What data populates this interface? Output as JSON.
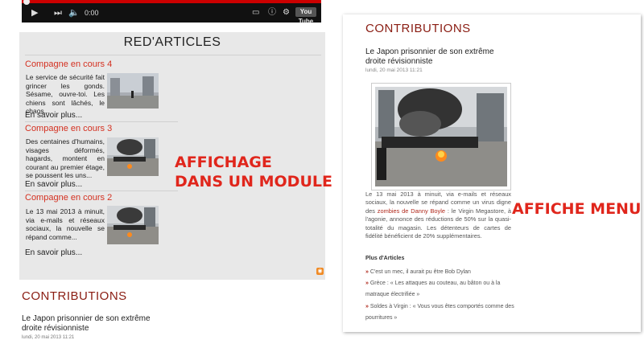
{
  "player": {
    "time": "0:00",
    "youtube_label": "You Tube"
  },
  "module": {
    "title": "RED'ARTICLES",
    "articles": [
      {
        "title": "Compagne en cours 4",
        "text": "Le service de sécurité fait grincer les gonds. Sésame, ouvre-toi. Les chiens sont lâchés, le chaos...",
        "more": "En savoir plus..."
      },
      {
        "title": "Compagne en cours 3",
        "text": "Des centaines d'humains, visages déformés, hagards, montent en courant au premier étage, se poussent les uns...",
        "more": "En savoir plus..."
      },
      {
        "title": "Compagne en cours 2",
        "text": "Le 13 mai 2013 à minuit, via e-mails et réseaux sociaux, la nouvelle se répand comme...",
        "more": "En savoir plus..."
      }
    ]
  },
  "overlays": {
    "module_label_1": "AFFICHAGE",
    "module_label_2": "DANS UN MODULE",
    "menu_label": "AFFICHE MENU"
  },
  "contrib_left": {
    "title": "CONTRIBUTIONS",
    "article_title": "Le Japon prisonnier de son extrême droite révisionniste",
    "date": "lundi, 20 mai 2013 11:21"
  },
  "contrib_right": {
    "title": "CONTRIBUTIONS",
    "article_title": "Le Japon prisonnier de son extrême droite révisionniste",
    "date": "lundi, 20 mai 2013 11:21",
    "body_1": "Le 13 mai 2013 à minuit, via e-mails et réseaux sociaux, la nouvelle se répand comme un virus digne des ",
    "body_link": "zombies de Danny Boyle",
    "body_2": " : le Virgin Megastore, à l'agonie, annonce des réductions de 50% sur la quasi-totalité du magasin. Les détenteurs de cartes de fidélité bénéficient de 20% supplémentaires.",
    "plus_heading": "Plus d'Articles",
    "plus_items": [
      "C'est un mec, il aurait pu être Bob Dylan",
      "Grèce : « Les attaques au couteau, au bâton ou à la matraque électrifiée »",
      "Soldes à Virgin : « Vous vous êtes comportés comme des pourritures »"
    ]
  }
}
